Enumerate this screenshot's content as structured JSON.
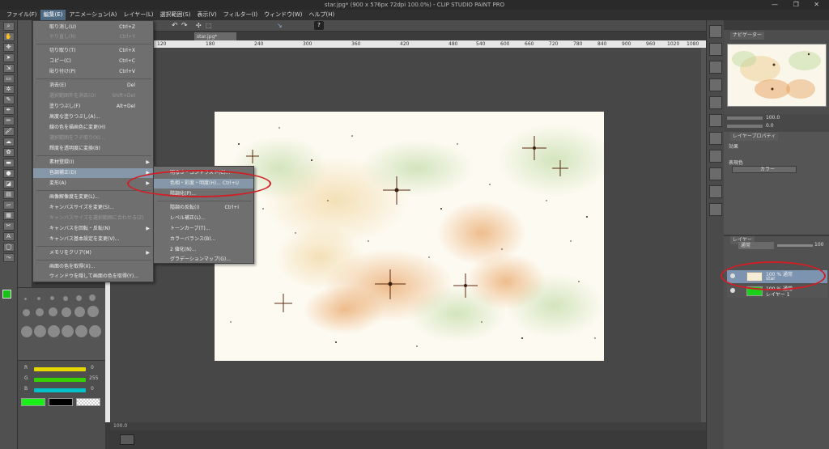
{
  "window": {
    "title": "star.jpg* (900 x 576px 72dpi 100.0%) - CLIP STUDIO PAINT PRO",
    "controls": "— ❐ ✕"
  },
  "menubar": [
    "ファイル(F)",
    "編集(E)",
    "アニメーション(A)",
    "レイヤー(L)",
    "選択範囲(S)",
    "表示(V)",
    "フィルター(I)",
    "ウィンドウ(W)",
    "ヘルプ(H)"
  ],
  "document_tab": "star.jpg*",
  "ruler_labels": [
    "120",
    "180",
    "240",
    "300",
    "360",
    "420",
    "480",
    "540",
    "600",
    "660",
    "720",
    "780",
    "840",
    "900",
    "960",
    "1020",
    "1080"
  ],
  "edit_menu": {
    "items": [
      {
        "label": "取り消し(U)",
        "shortcut": "Ctrl+Z",
        "disabled": false
      },
      {
        "label": "やり直し(R)",
        "shortcut": "Ctrl+Y",
        "disabled": true
      },
      {
        "label": "切り取り(T)",
        "shortcut": "Ctrl+X",
        "disabled": false
      },
      {
        "label": "コピー(C)",
        "shortcut": "Ctrl+C",
        "disabled": false
      },
      {
        "label": "貼り付け(P)",
        "shortcut": "Ctrl+V",
        "disabled": false
      },
      {
        "label": "消去(E)",
        "shortcut": "Del",
        "disabled": false
      },
      {
        "label": "選択範囲外を消去(O)",
        "shortcut": "Shift+Del",
        "disabled": true
      },
      {
        "label": "塗りつぶし(F)",
        "shortcut": "Alt+Del",
        "disabled": false
      },
      {
        "label": "高度な塗りつぶし(A)...",
        "shortcut": "",
        "disabled": false
      },
      {
        "label": "線の色を描画色に変更(H)",
        "shortcut": "",
        "disabled": false
      },
      {
        "label": "選択範囲をフチ取り(X)...",
        "shortcut": "",
        "disabled": true
      },
      {
        "label": "輝度を透明度に変換(B)",
        "shortcut": "",
        "disabled": false
      },
      {
        "label": "素材登録(I)",
        "shortcut": "",
        "disabled": false
      },
      {
        "label": "色調補正(D)",
        "shortcut": "",
        "disabled": false
      },
      {
        "label": "変形(A)",
        "shortcut": "",
        "disabled": false
      },
      {
        "label": "画像解像度を変更(L)...",
        "shortcut": "",
        "disabled": false
      },
      {
        "label": "キャンバスサイズを変更(S)...",
        "shortcut": "",
        "disabled": false
      },
      {
        "label": "キャンバスサイズを選択範囲に合わせる(Z)",
        "shortcut": "",
        "disabled": true
      },
      {
        "label": "キャンバスを回転・反転(N)",
        "shortcut": "",
        "disabled": false
      },
      {
        "label": "キャンバス基本設定を変更(V)...",
        "shortcut": "",
        "disabled": false
      },
      {
        "label": "メモリをクリア(M)",
        "shortcut": "",
        "disabled": false
      },
      {
        "label": "画面の色を取得(X)...",
        "shortcut": "",
        "disabled": false
      },
      {
        "label": "ウィンドウを隠して画面の色を取得(Y)...",
        "shortcut": "",
        "disabled": false
      }
    ]
  },
  "color_submenu": {
    "items": [
      {
        "label": "明るさ・コントラスト(C)...",
        "shortcut": ""
      },
      {
        "label": "色相・彩度・明度(H)...",
        "shortcut": "Ctrl+U"
      },
      {
        "label": "階調化(P)...",
        "shortcut": ""
      },
      {
        "label": "階調の反転(I)",
        "shortcut": "Ctrl+I"
      },
      {
        "label": "レベル補正(L)...",
        "shortcut": ""
      },
      {
        "label": "トーンカーブ(T)...",
        "shortcut": ""
      },
      {
        "label": "カラーバランス(B)...",
        "shortcut": ""
      },
      {
        "label": "2 値化(N)...",
        "shortcut": ""
      },
      {
        "label": "グラデーションマップ(G)...",
        "shortcut": ""
      }
    ]
  },
  "color_sliders": [
    {
      "label": "R",
      "value": "0",
      "color": "#e4d800",
      "fill": 1.0
    },
    {
      "label": "G",
      "value": "255",
      "color": "#36d000",
      "fill": 1.0
    },
    {
      "label": "B",
      "value": "0",
      "color": "#00c0c8",
      "fill": 1.0
    }
  ],
  "colors": {
    "main": "#19c119",
    "sub": "#000000",
    "accent_highlight": "#8597a8",
    "annotation_ring": "#d01f26"
  },
  "status": {
    "zoom": "100.0"
  },
  "navigator": {
    "tab": "ナビゲーター",
    "zoom": "100.0",
    "angle": "0.0"
  },
  "properties": {
    "tab": "レイヤープロパティ",
    "effect_label": "効果",
    "expression_label": "表現色",
    "expression_value": "カラー"
  },
  "layers": {
    "tab": "レイヤー",
    "blend": "通常",
    "opacity": "100",
    "rows": [
      {
        "line1": "100 % 通常",
        "line2": "star",
        "thumb_color": "#f5ecd6",
        "selected": true
      },
      {
        "line1": "100 % 通常",
        "line2": "レイヤー 1",
        "thumb_color": "#19d119",
        "selected": false
      }
    ]
  }
}
